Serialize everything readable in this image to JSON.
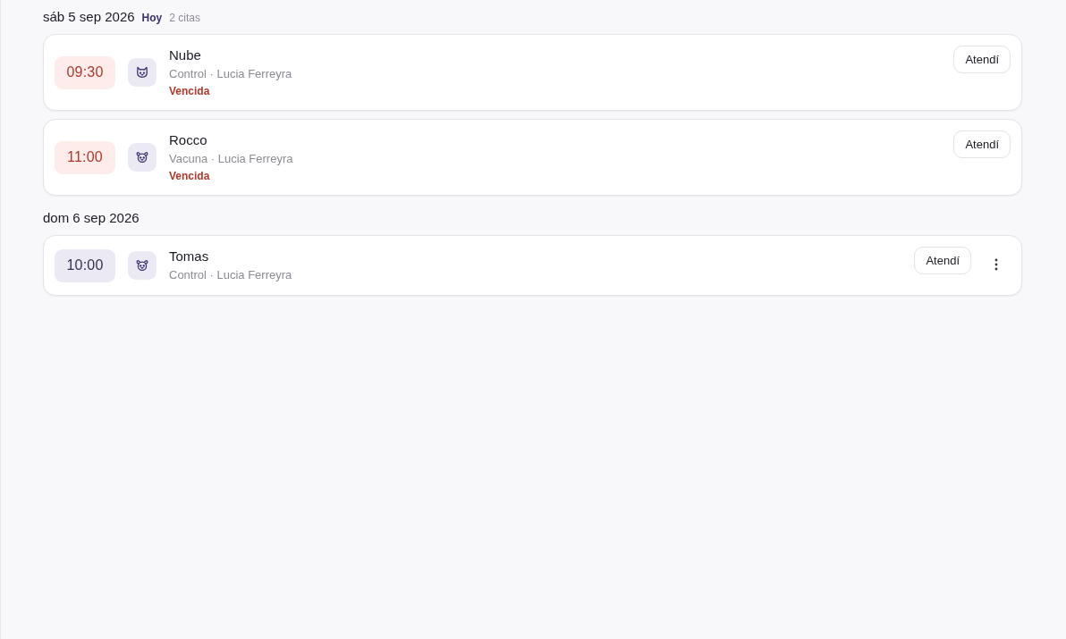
{
  "days": [
    {
      "date": "sáb 5 sep 2026",
      "today_label": "Hoy",
      "count": "2 citas",
      "appointments": [
        {
          "time": "09:30",
          "overdue": true,
          "kind": "cat",
          "name": "Nube",
          "detail": "Control · Lucia Ferreyra",
          "status": "Vencida",
          "action": "Atendí",
          "menu": false
        },
        {
          "time": "11:00",
          "overdue": true,
          "kind": "dog",
          "name": "Rocco",
          "detail": "Vacuna · Lucia Ferreyra",
          "status": "Vencida",
          "action": "Atendí",
          "menu": false
        }
      ]
    },
    {
      "date": "dom 6 sep 2026",
      "appointments": [
        {
          "time": "10:00",
          "overdue": false,
          "kind": "dog",
          "name": "Tomas",
          "detail": "Control · Lucia Ferreyra",
          "action": "Atendí",
          "menu": true
        }
      ]
    }
  ]
}
